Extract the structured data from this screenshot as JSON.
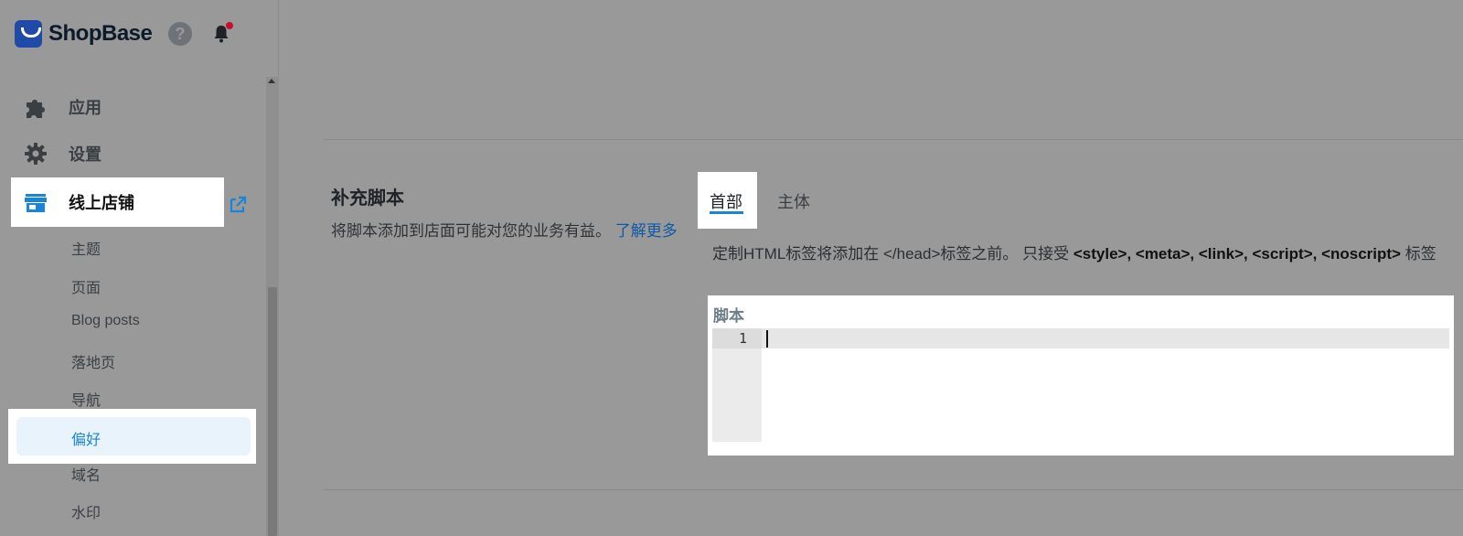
{
  "brand": {
    "name": "ShopBase"
  },
  "header_icons": {
    "help": "?"
  },
  "sidebar": {
    "items": [
      {
        "label": "应用",
        "icon": "puzzle-icon"
      },
      {
        "label": "设置",
        "icon": "gear-icon"
      },
      {
        "label": "线上店铺",
        "icon": "store-icon"
      }
    ],
    "sub_items": [
      "主题",
      "页面",
      "Blog posts",
      "落地页",
      "导航",
      "偏好",
      "域名",
      "水印"
    ],
    "active_sub": "偏好"
  },
  "section": {
    "title": "补充脚本",
    "description": "将脚本添加到店面可能对您的业务有益。",
    "learn_more": "了解更多"
  },
  "tabs": [
    {
      "label": "首部",
      "active": true
    },
    {
      "label": "主体",
      "active": false
    }
  ],
  "tab_description": {
    "prefix": "定制HTML标签将添加在 </head>标签之前。 只接受 ",
    "tags": "<style>, <meta>, <link>, <script>, <noscript>",
    "suffix": " 标签"
  },
  "editor": {
    "label": "脚本",
    "line_numbers": [
      "1"
    ]
  },
  "colors": {
    "accent": "#1a85d6",
    "link": "#0e5aa7",
    "overlay": "#999999"
  }
}
